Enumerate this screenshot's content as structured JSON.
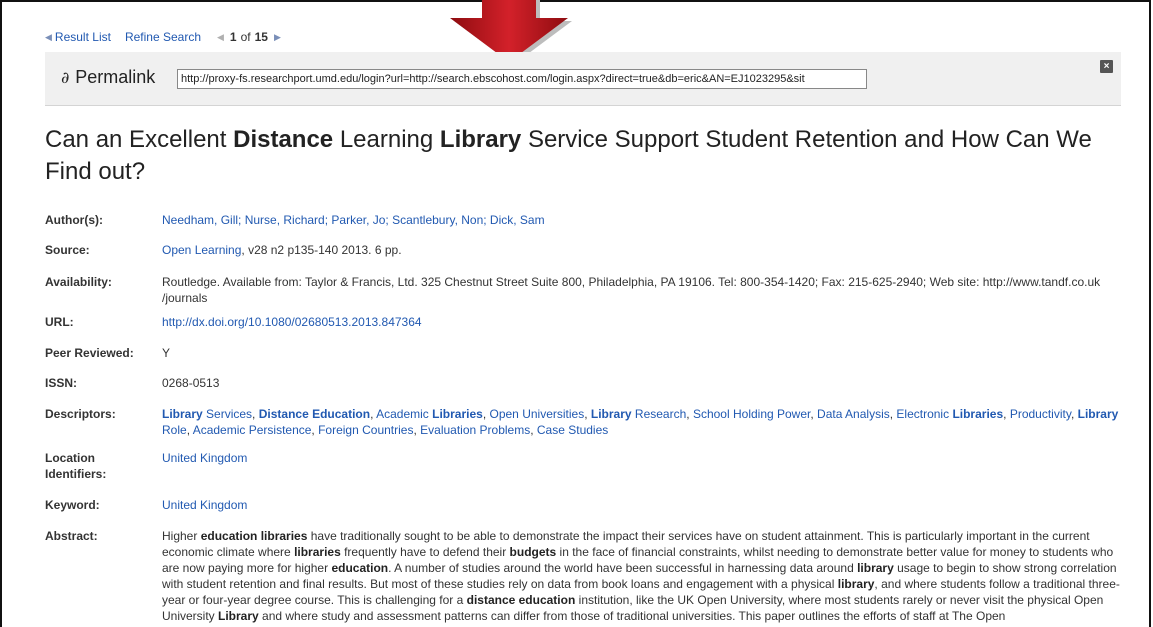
{
  "nav": {
    "result_list": "Result List",
    "refine_search": "Refine Search",
    "pager_current": "1",
    "pager_of": "of",
    "pager_total": "15"
  },
  "permalink": {
    "label": "Permalink",
    "url": "http://proxy-fs.researchport.umd.edu/login?url=http://search.ebscohost.com/login.aspx?direct=true&db=eric&AN=EJ1023295&sit"
  },
  "title": {
    "parts": [
      "Can an Excellent ",
      "Distance",
      " Learning ",
      "Library",
      " Service Support Student Retention and How Can We Find out?"
    ]
  },
  "fields": {
    "authors_label": "Author(s):",
    "authors": "Needham, Gill; Nurse, Richard; Parker, Jo; Scantlebury, Non; Dick, Sam",
    "source_label": "Source:",
    "source_link": "Open Learning",
    "source_rest": ", v28 n2 p135-140 2013. 6 pp.",
    "availability_label": "Availability:",
    "availability": "Routledge. Available from: Taylor & Francis, Ltd. 325 Chestnut Street Suite 800, Philadelphia, PA 19106. Tel: 800-354-1420; Fax: 215-625-2940; Web site: http://www.tandf.co.uk /journals",
    "url_label": "URL:",
    "url": "http://dx.doi.org/10.1080/02680513.2013.847364",
    "peer_label": "Peer Reviewed:",
    "peer": "Y",
    "issn_label": "ISSN:",
    "issn": "0268-0513",
    "descriptors_label": "Descriptors:",
    "location_label": "Location Identifiers:",
    "location": "United Kingdom",
    "keyword_label": "Keyword:",
    "keyword": "United Kingdom",
    "abstract_label": "Abstract:"
  },
  "descriptors": [
    {
      "b": "Library",
      "t": " Services"
    },
    {
      "b": "Distance Education",
      "t": ""
    },
    {
      "b": "",
      "t": "Academic ",
      "b2": "Libraries"
    },
    {
      "b": "",
      "t": "Open Universities"
    },
    {
      "b": "Library",
      "t": " Research"
    },
    {
      "b": "",
      "t": "School Holding Power"
    },
    {
      "b": "",
      "t": "Data Analysis"
    },
    {
      "b": "",
      "t": "Electronic ",
      "b2": "Libraries"
    },
    {
      "b": "",
      "t": "Productivity"
    },
    {
      "b": "Library",
      "t": " Role"
    },
    {
      "b": "",
      "t": "Academic Persistence"
    },
    {
      "b": "",
      "t": "Foreign Countries"
    },
    {
      "b": "",
      "t": "Evaluation Problems"
    },
    {
      "b": "",
      "t": "Case Studies"
    }
  ],
  "abstract": [
    {
      "t": "Higher "
    },
    {
      "b": "education libraries"
    },
    {
      "t": " have traditionally sought to be able to demonstrate the impact their services have on student attainment. This is particularly important in the current economic climate where "
    },
    {
      "b": "libraries"
    },
    {
      "t": " frequently have to defend their "
    },
    {
      "b": "budgets"
    },
    {
      "t": " in the face of financial constraints, whilst needing to demonstrate better value for money to students who are now paying more for higher "
    },
    {
      "b": "education"
    },
    {
      "t": ". A number of studies around the world have been successful in harnessing data around "
    },
    {
      "b": "library"
    },
    {
      "t": " usage to begin to show strong correlation with student retention and final results. But most of these studies rely on data from book loans and engagement with a physical "
    },
    {
      "b": "library"
    },
    {
      "t": ", and where students follow a traditional three-year or four-year degree course. This is challenging for a "
    },
    {
      "b": "distance education"
    },
    {
      "t": " institution, like the UK Open University, where most students rarely or never visit the physical Open University "
    },
    {
      "b": "Library"
    },
    {
      "t": " and where study and assessment patterns can differ from those of traditional universities. This paper outlines the efforts of staff at The Open"
    }
  ],
  "colors": {
    "link": "#2159b1",
    "arrow": "#c0141b",
    "bar": "#f0f0f0"
  }
}
